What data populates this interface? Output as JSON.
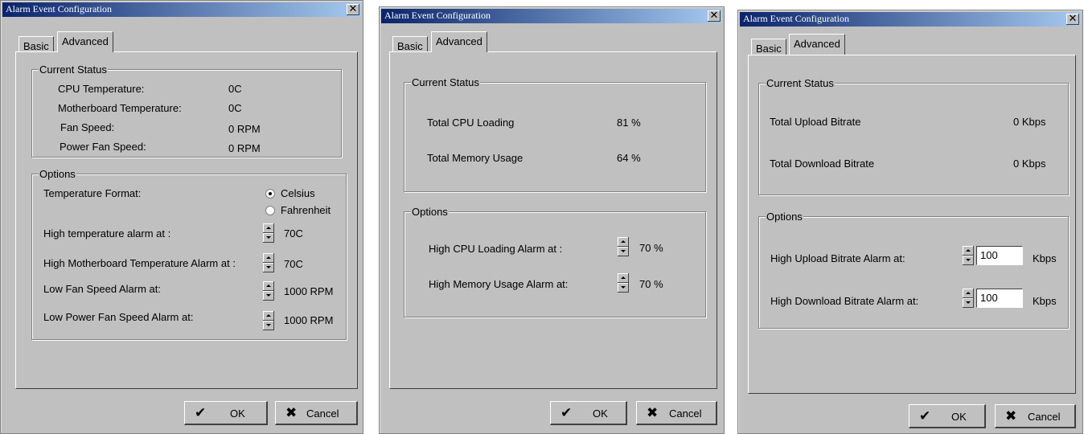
{
  "window_title": "Alarm Event Configuration",
  "close_glyph": "✕",
  "tabs": {
    "basic": "Basic",
    "advanced": "Advanced"
  },
  "buttons": {
    "ok": "OK",
    "cancel": "Cancel",
    "ok_icon": "✔",
    "cancel_icon": "✖"
  },
  "sections": {
    "status": "Current Status",
    "options": "Options"
  },
  "dialog1": {
    "status": [
      {
        "label": "CPU Temperature:",
        "value": "0C"
      },
      {
        "label": "Motherboard Temperature:",
        "value": "0C"
      },
      {
        "label": "Fan Speed:",
        "value": "0 RPM"
      },
      {
        "label": "Power Fan Speed:",
        "value": "0 RPM"
      }
    ],
    "temperature_format_label": "Temperature Format:",
    "radio_celsius": "Celsius",
    "radio_fahrenheit": "Fahrenheit",
    "selected_format": "Celsius",
    "options": [
      {
        "label": "High temperature alarm at :",
        "value": "70C"
      },
      {
        "label": "High Motherboard Temperature Alarm at :",
        "value": "70C"
      },
      {
        "label": "Low Fan Speed Alarm at:",
        "value": "1000 RPM"
      },
      {
        "label": "Low Power Fan Speed Alarm at:",
        "value": "1000 RPM"
      }
    ]
  },
  "dialog2": {
    "status": [
      {
        "label": "Total CPU Loading",
        "value": "81 %"
      },
      {
        "label": "Total Memory Usage",
        "value": "64 %"
      }
    ],
    "options": [
      {
        "label": "High CPU Loading Alarm at :",
        "value": "70 %"
      },
      {
        "label": "High Memory Usage Alarm at:",
        "value": "70 %"
      }
    ]
  },
  "dialog3": {
    "status": [
      {
        "label": "Total Upload Bitrate",
        "value": "0 Kbps"
      },
      {
        "label": "Total Download Bitrate",
        "value": "0 Kbps"
      }
    ],
    "options": [
      {
        "label": "High Upload Bitrate Alarm at:",
        "value": "100",
        "unit": "Kbps"
      },
      {
        "label": "High Download Bitrate Alarm at:",
        "value": "100",
        "unit": "Kbps"
      }
    ]
  },
  "colors": {
    "title_start": "#0a246a",
    "title_end": "#a6caf0",
    "face": "#c0c0c0"
  }
}
